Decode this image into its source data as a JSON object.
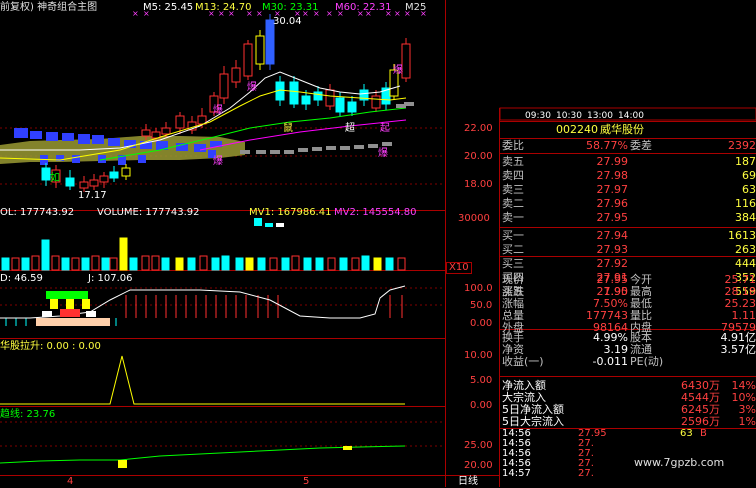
{
  "main_chart": {
    "title": "前复权) 神奇组合主图",
    "m5_label": "M5: 25.45",
    "m13_label": "M13: 24.70",
    "m30_label": "M30: 23.31",
    "m60_label": "M60: 22.31",
    "m250_label": "M25",
    "high_label": "30.04",
    "low_label": "17.17",
    "price_ticks": [
      "22.00",
      "20.00",
      "18.00"
    ],
    "annotations": [
      "爆",
      "爆",
      "爆",
      "爆",
      "爆",
      "鼠",
      "超",
      "起",
      "如"
    ],
    "colors": {
      "up": "#ff3030",
      "down": "#00ffff",
      "m5": "#ffffff",
      "m13": "#ffff00",
      "m30": "#00ff00",
      "m60": "#ff00ff",
      "cloud": "#9a9a32"
    }
  },
  "volume_panel": {
    "vol_label": "OL: 177743.92",
    "volume_label": "VOLUME: 177743.92",
    "mv1_label": "MV1: 167986.41",
    "mv2_label": "MV2: 145554.80",
    "tick_30000": "30000",
    "x10": "X10"
  },
  "kdj_panel": {
    "d_label": "D: 46.59",
    "j_label": "J: 107.06",
    "ticks": [
      "100.0",
      "50.0",
      "0.00"
    ]
  },
  "indicator_panel": {
    "title": "华股拉升: 0.00 : 0.00",
    "ticks": [
      "10.00",
      "5.00",
      "0.00"
    ]
  },
  "trend_panel": {
    "title": "趋线: 23.76",
    "ticks": [
      "25.00",
      "20.00"
    ]
  },
  "bottom_axis": {
    "label_4": "4",
    "label_5": "5",
    "period": "日线"
  },
  "quote": {
    "time_axis": [
      "09:30",
      "10:30",
      "13:00",
      "14:00"
    ],
    "code": "002240",
    "name": "威华股份",
    "weibi_label": "委比",
    "weibi_value": "58.77%",
    "weicha_label": "委差",
    "weicha_value": "2392",
    "asks": [
      {
        "label": "卖五",
        "price": "27.99",
        "vol": "187"
      },
      {
        "label": "卖四",
        "price": "27.98",
        "vol": "69"
      },
      {
        "label": "卖三",
        "price": "27.97",
        "vol": "63"
      },
      {
        "label": "卖二",
        "price": "27.96",
        "vol": "116"
      },
      {
        "label": "卖一",
        "price": "27.95",
        "vol": "384"
      }
    ],
    "bids": [
      {
        "label": "买一",
        "price": "27.94",
        "vol": "1613"
      },
      {
        "label": "买二",
        "price": "27.93",
        "vol": "263"
      },
      {
        "label": "买三",
        "price": "27.92",
        "vol": "444"
      },
      {
        "label": "买四",
        "price": "27.91",
        "vol": "352"
      },
      {
        "label": "买五",
        "price": "27.90",
        "vol": "559"
      }
    ],
    "stats": [
      {
        "l1": "现价",
        "v1": "27.95",
        "l2": "今开",
        "v2": "25.71"
      },
      {
        "l1": "涨跌",
        "v1": "1.95",
        "l2": "最高",
        "v2": "28.18"
      },
      {
        "l1": "涨幅",
        "v1": "7.50%",
        "l2": "最低",
        "v2": "25.23"
      },
      {
        "l1": "总量",
        "v1": "177743",
        "l2": "量比",
        "v2": "1.11"
      },
      {
        "l1": "外盘",
        "v1": "98164",
        "l2": "内盘",
        "v2": "79579"
      }
    ],
    "stats2": [
      {
        "l1": "换手",
        "v1": "4.99%",
        "l2": "股本",
        "v2": "4.91亿"
      },
      {
        "l1": "净资",
        "v1": "3.19",
        "l2": "流通",
        "v2": "3.57亿"
      },
      {
        "l1": "收益(一)",
        "v1": "-0.011",
        "l2": "PE(动)",
        "v2": ""
      }
    ],
    "flows": [
      {
        "label": "净流入额",
        "value": "6430万",
        "pct": "14%"
      },
      {
        "label": "大宗流入",
        "value": "4544万",
        "pct": "10%"
      },
      {
        "label": "5日净流入额",
        "value": "6245万",
        "pct": "3%"
      },
      {
        "label": "5日大宗流入",
        "value": "2596万",
        "pct": "1%"
      }
    ],
    "ticks": [
      {
        "time": "14:56",
        "price": "27.95",
        "vol": "63",
        "flag": "B"
      },
      {
        "time": "14:56",
        "price": "27.",
        "vol": "",
        "flag": ""
      },
      {
        "time": "14:56",
        "price": "27.",
        "vol": "",
        "flag": ""
      },
      {
        "time": "14:56",
        "price": "27.",
        "vol": "",
        "flag": ""
      },
      {
        "time": "14:57",
        "price": "27.",
        "vol": "",
        "flag": ""
      }
    ],
    "watermark": "www.7gpzb.com"
  }
}
